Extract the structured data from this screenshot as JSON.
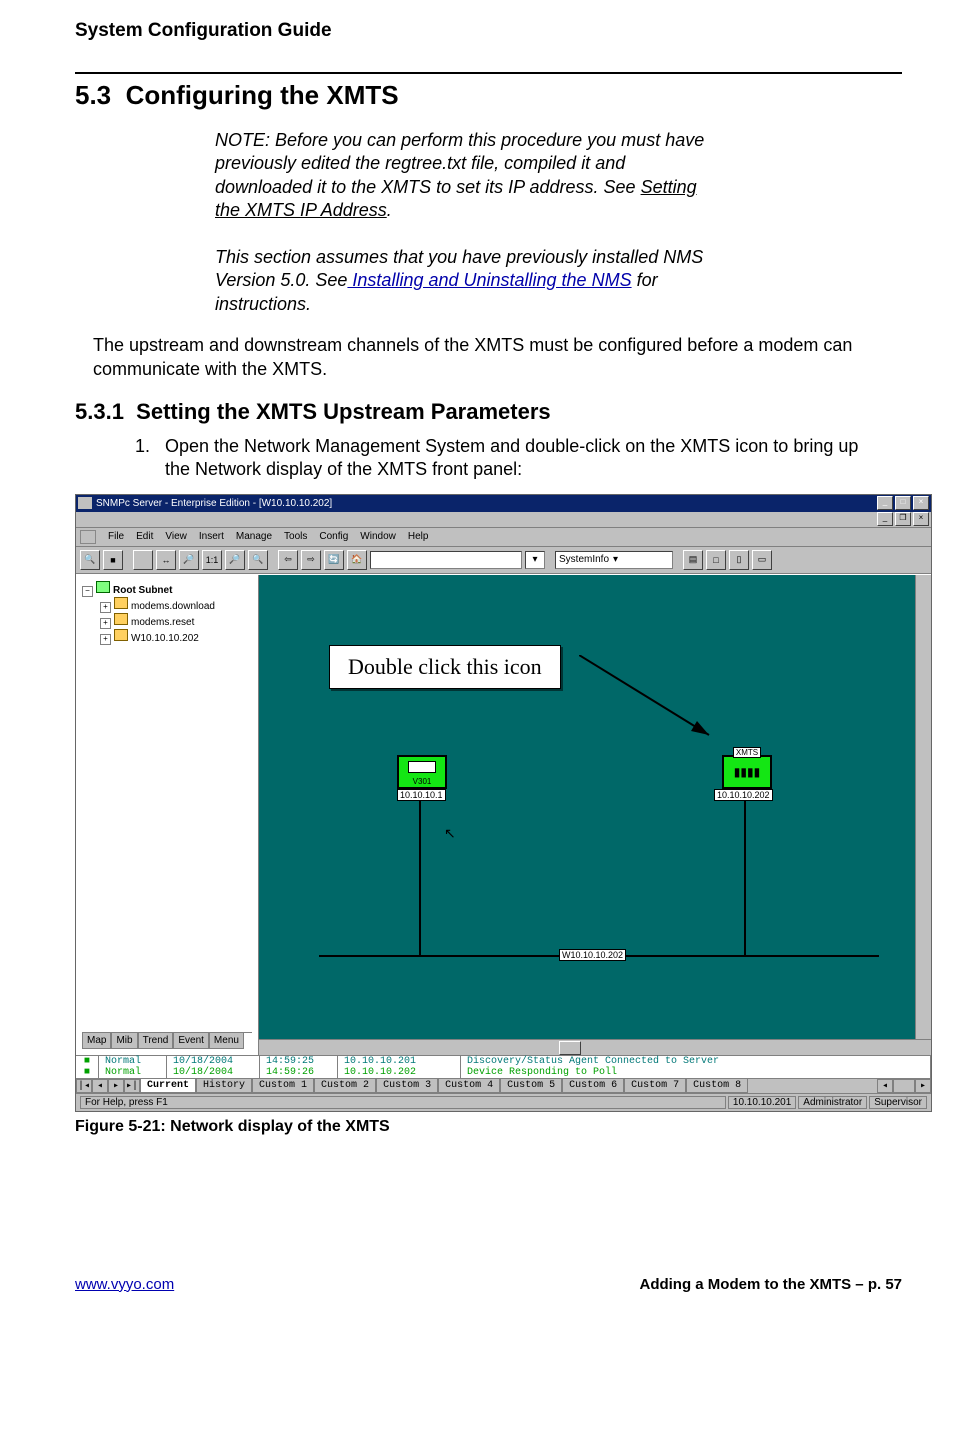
{
  "doc": {
    "header_title": "System Configuration Guide",
    "section_num": "5.3",
    "section_title": "Configuring the XMTS",
    "note_l1": "NOTE:  Before you can perform this procedure you must have previously edited the regtree.txt file, compiled it and downloaded it to the XMTS to set its IP address.  See ",
    "note_link1": "Setting the XMTS IP Address",
    "note_l1_end": ".",
    "note_l2": "This section assumes that you have previously installed NMS Version 5.0.  See",
    "note_link2": " Installing and Uninstalling the NMS",
    "note_l2_end": "  for instructions.",
    "body_p": "The upstream and downstream channels of the XMTS must be configured before a modem can communicate with the XMTS.",
    "subsec_num": "5.3.1",
    "subsec_title": "Setting the XMTS Upstream Parameters",
    "step1_num": "1.",
    "step1_txt": "Open the Network Management System  and double-click on the XMTS icon to bring up the Network display of the XMTS front panel:",
    "fig_caption": "Figure 5-21: Network display of the XMTS",
    "footer_url": "www.vyyo.com",
    "footer_right": "Adding a Modem to the XMTS – p. 57"
  },
  "app": {
    "title": "SNMPc Server - Enterprise Edition - [W10.10.10.202]",
    "menus": [
      "File",
      "Edit",
      "View",
      "Insert",
      "Manage",
      "Tools",
      "Config",
      "Window",
      "Help"
    ],
    "toolbar": {
      "buttons": [
        "🔍",
        "■",
        "",
        "↔",
        "🔎",
        "1:1",
        "🔎",
        "🔍",
        "⇦",
        "⇨",
        "🔄",
        "🏠"
      ],
      "dropdown_label": "SystemInfo"
    },
    "tree": {
      "root": "Root Subnet",
      "children": [
        "modems.download",
        "modems.reset",
        "W10.10.10.202"
      ],
      "tabs": [
        "Map",
        "Mib",
        "Trend",
        "Event",
        "Menu"
      ]
    },
    "net": {
      "node1_label": "V301",
      "node1_ip": "10.10.10.1",
      "node2_label": "XMTS",
      "node2_ip": "10.10.10.202",
      "link_label": "W10.10.10.202",
      "annotation": "Double click this icon"
    },
    "events": {
      "rows": [
        {
          "marker": "■",
          "level": "Normal",
          "date": "10/18/2004",
          "time": "14:59:25",
          "ip": "10.10.10.201",
          "msg": "Discovery/Status Agent Connected to Server",
          "cls": "teal"
        },
        {
          "marker": "■",
          "level": "Normal",
          "date": "10/18/2004",
          "time": "14:59:26",
          "ip": "10.10.10.202",
          "msg": "Device Responding to Poll",
          "cls": "lime"
        }
      ],
      "tabs": [
        "Current",
        "History",
        "Custom 1",
        "Custom 2",
        "Custom 3",
        "Custom 4",
        "Custom 5",
        "Custom 6",
        "Custom 7",
        "Custom 8"
      ]
    },
    "status": {
      "help": "For Help, press F1",
      "ip": "10.10.10.201",
      "user": "Administrator",
      "role": "Supervisor"
    }
  }
}
